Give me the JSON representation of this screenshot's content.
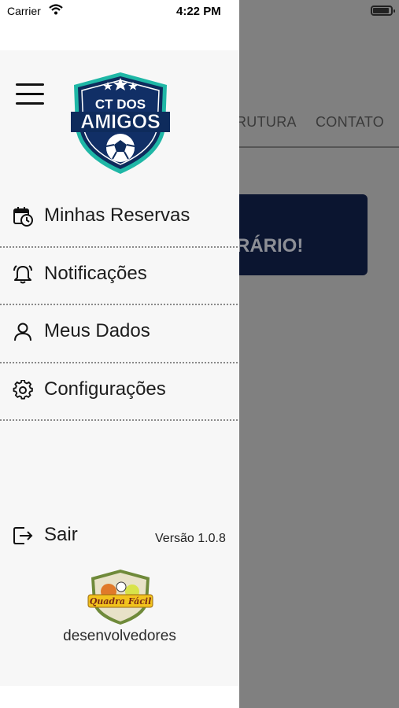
{
  "status_bar": {
    "carrier": "Carrier",
    "time": "4:22 PM",
    "wifi_icon": "wifi-icon",
    "battery_icon": "battery-icon"
  },
  "background": {
    "tabs": [
      "RUTURA",
      "CONTATO"
    ],
    "banner_lines": [
      "",
      "RÁRIO!"
    ],
    "banner_color": "#0b1530"
  },
  "drawer": {
    "menu_icon": "hamburger-icon",
    "logo": {
      "line1": "CT DOS",
      "line2": "AMIGOS",
      "primary_color": "#0e2b5c",
      "accent_color": "#1fb7a6"
    },
    "items": [
      {
        "label": "Minhas Reservas",
        "icon": "calendar-clock-icon"
      },
      {
        "label": "Notificações",
        "icon": "bell-icon"
      },
      {
        "label": "Meus Dados",
        "icon": "user-icon"
      },
      {
        "label": "Configurações",
        "icon": "gear-icon"
      }
    ],
    "exit": {
      "label": "Sair",
      "icon": "logout-icon"
    },
    "version": "Versão 1.0.8",
    "developer": {
      "logo_text": "Quadra Fácil",
      "label": "desenvolvedores"
    }
  }
}
